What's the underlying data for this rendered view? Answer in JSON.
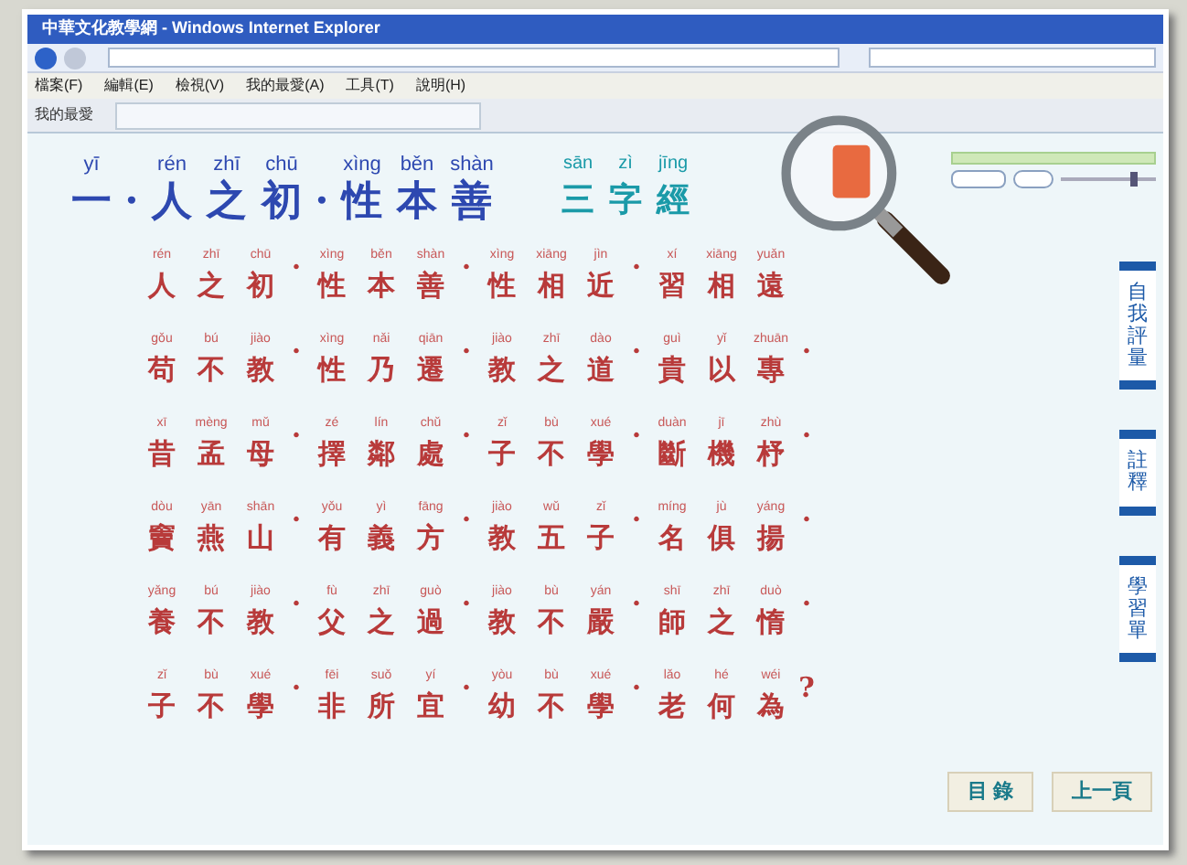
{
  "window": {
    "title": "中華文化教學網 - Windows Internet Explorer"
  },
  "menu": [
    "檔案(F)",
    "編輯(E)",
    "檢視(V)",
    "我的最愛(A)",
    "工具(T)",
    "說明(H)"
  ],
  "favorites": {
    "label": "我的最愛"
  },
  "heading": {
    "lesson": [
      {
        "p": "yī",
        "c": "一"
      },
      {
        "c": "·"
      },
      {
        "p": "rén",
        "c": "人"
      },
      {
        "p": "zhī",
        "c": "之"
      },
      {
        "p": "chū",
        "c": "初"
      },
      {
        "c": "·"
      },
      {
        "p": "xìng",
        "c": "性"
      },
      {
        "p": "běn",
        "c": "本"
      },
      {
        "p": "shàn",
        "c": "善"
      }
    ],
    "book": [
      {
        "p": "sān",
        "c": "三"
      },
      {
        "p": "zì",
        "c": "字"
      },
      {
        "p": "jīng",
        "c": "經"
      }
    ]
  },
  "verses": [
    {
      "cells": [
        {
          "p": "rén",
          "c": "人"
        },
        {
          "p": "zhī",
          "c": "之"
        },
        {
          "p": "chū",
          "c": "初"
        },
        {
          "c": "·"
        },
        {
          "p": "xìng",
          "c": "性"
        },
        {
          "p": "běn",
          "c": "本"
        },
        {
          "p": "shàn",
          "c": "善"
        },
        {
          "c": "·"
        },
        {
          "p": "xìng",
          "c": "性"
        },
        {
          "p": "xiāng",
          "c": "相"
        },
        {
          "p": "jìn",
          "c": "近"
        },
        {
          "c": "·"
        },
        {
          "p": "xí",
          "c": "習"
        },
        {
          "p": "xiāng",
          "c": "相"
        },
        {
          "p": "yuǎn",
          "c": "遠"
        }
      ]
    },
    {
      "cells": [
        {
          "p": "gǒu",
          "c": "苟"
        },
        {
          "p": "bú",
          "c": "不"
        },
        {
          "p": "jiào",
          "c": "教"
        },
        {
          "c": "·"
        },
        {
          "p": "xìng",
          "c": "性"
        },
        {
          "p": "nǎi",
          "c": "乃"
        },
        {
          "p": "qiān",
          "c": "遷"
        },
        {
          "c": "·"
        },
        {
          "p": "jiào",
          "c": "教"
        },
        {
          "p": "zhī",
          "c": "之"
        },
        {
          "p": "dào",
          "c": "道"
        },
        {
          "c": "·"
        },
        {
          "p": "guì",
          "c": "貴"
        },
        {
          "p": "yǐ",
          "c": "以"
        },
        {
          "p": "zhuān",
          "c": "專"
        },
        {
          "c": "·"
        }
      ]
    },
    {
      "cells": [
        {
          "p": "xī",
          "c": "昔"
        },
        {
          "p": "mèng",
          "c": "孟"
        },
        {
          "p": "mǔ",
          "c": "母"
        },
        {
          "c": "·"
        },
        {
          "p": "zé",
          "c": "擇"
        },
        {
          "p": "lín",
          "c": "鄰"
        },
        {
          "p": "chǔ",
          "c": "處"
        },
        {
          "c": "·"
        },
        {
          "p": "zǐ",
          "c": "子"
        },
        {
          "p": "bù",
          "c": "不"
        },
        {
          "p": "xué",
          "c": "學"
        },
        {
          "c": "·"
        },
        {
          "p": "duàn",
          "c": "斷"
        },
        {
          "p": "jī",
          "c": "機"
        },
        {
          "p": "zhù",
          "c": "杼"
        },
        {
          "c": "·"
        }
      ]
    },
    {
      "cells": [
        {
          "p": "dòu",
          "c": "竇"
        },
        {
          "p": "yān",
          "c": "燕"
        },
        {
          "p": "shān",
          "c": "山"
        },
        {
          "c": "·"
        },
        {
          "p": "yǒu",
          "c": "有"
        },
        {
          "p": "yì",
          "c": "義"
        },
        {
          "p": "fāng",
          "c": "方"
        },
        {
          "c": "·"
        },
        {
          "p": "jiào",
          "c": "教"
        },
        {
          "p": "wǔ",
          "c": "五"
        },
        {
          "p": "zǐ",
          "c": "子"
        },
        {
          "c": "·"
        },
        {
          "p": "míng",
          "c": "名"
        },
        {
          "p": "jù",
          "c": "俱"
        },
        {
          "p": "yáng",
          "c": "揚"
        },
        {
          "c": "·"
        }
      ]
    },
    {
      "cells": [
        {
          "p": "yǎng",
          "c": "養"
        },
        {
          "p": "bú",
          "c": "不"
        },
        {
          "p": "jiào",
          "c": "教"
        },
        {
          "c": "·"
        },
        {
          "p": "fù",
          "c": "父"
        },
        {
          "p": "zhī",
          "c": "之"
        },
        {
          "p": "guò",
          "c": "過"
        },
        {
          "c": "·"
        },
        {
          "p": "jiào",
          "c": "教"
        },
        {
          "p": "bù",
          "c": "不"
        },
        {
          "p": "yán",
          "c": "嚴"
        },
        {
          "c": "·"
        },
        {
          "p": "shī",
          "c": "師"
        },
        {
          "p": "zhī",
          "c": "之"
        },
        {
          "p": "duò",
          "c": "惰"
        },
        {
          "c": "·"
        }
      ]
    },
    {
      "cells": [
        {
          "p": "zǐ",
          "c": "子"
        },
        {
          "p": "bù",
          "c": "不"
        },
        {
          "p": "xué",
          "c": "學"
        },
        {
          "c": "·"
        },
        {
          "p": "fēi",
          "c": "非"
        },
        {
          "p": "suǒ",
          "c": "所"
        },
        {
          "p": "yí",
          "c": "宜"
        },
        {
          "c": "·"
        },
        {
          "p": "yòu",
          "c": "幼"
        },
        {
          "p": "bù",
          "c": "不"
        },
        {
          "p": "xué",
          "c": "學"
        },
        {
          "c": "·"
        },
        {
          "p": "lǎo",
          "c": "老"
        },
        {
          "p": "hé",
          "c": "何"
        },
        {
          "p": "wéi",
          "c": "為"
        },
        {
          "c": "?"
        }
      ]
    }
  ],
  "player": {
    "progress": {
      "level": 1
    },
    "volume": {
      "level": 0.8
    }
  },
  "side_buttons": [
    "自我評量",
    "註釋",
    "學習單"
  ],
  "nav_buttons": [
    "目 錄",
    "上一頁"
  ]
}
